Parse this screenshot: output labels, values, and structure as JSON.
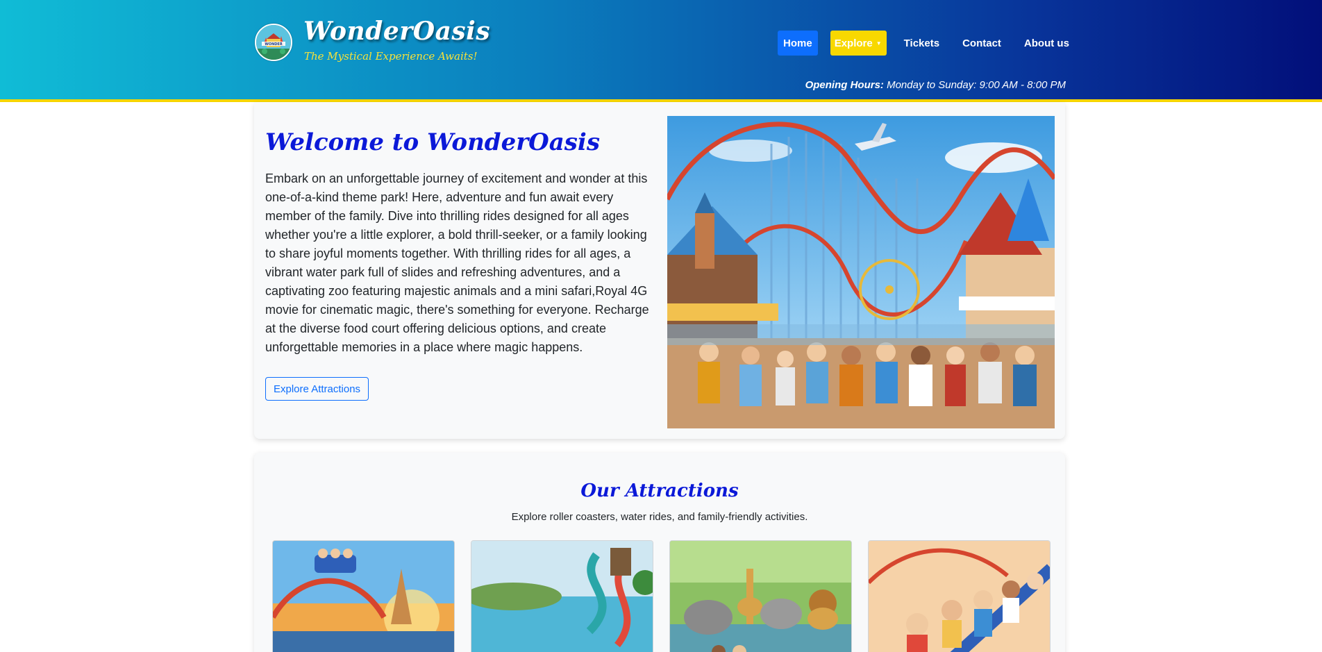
{
  "header": {
    "brand_name": "WonderOasis",
    "tagline": "The Mystical Experience Awaits!",
    "logo_label": "WONDER",
    "nav": {
      "home": "Home",
      "explore": "Explore",
      "tickets": "Tickets",
      "contact": "Contact",
      "about": "About us"
    },
    "hours_label": "Opening Hours:",
    "hours_value": "Monday to Sunday: 9:00 AM - 8:00 PM"
  },
  "welcome": {
    "title": "Welcome to WonderOasis",
    "body": "Embark on an unforgettable journey of excitement and wonder at this one-of-a-kind theme park! Here, adventure and fun await every member of the family. Dive into thrilling rides designed for all ages whether you're a little explorer, a bold thrill-seeker, or a family looking to share joyful moments together. With thrilling rides for all ages, a vibrant water park full of slides and refreshing adventures, and a captivating zoo featuring majestic animals and a mini safari,Royal 4G movie for cinematic magic, there's something for everyone. Recharge at the diverse food court offering delicious options, and create unforgettable memories in a place where magic happens.",
    "button": "Explore Attractions"
  },
  "attractions": {
    "title": "Our Attractions",
    "subtitle": "Explore roller coasters, water rides, and family-friendly activities."
  },
  "colors": {
    "header_start": "#10bcd6",
    "header_end": "#020f7a",
    "accent_yellow": "#f8d800",
    "primary_blue": "#0d6efd",
    "title_blue": "#0b19d8"
  }
}
